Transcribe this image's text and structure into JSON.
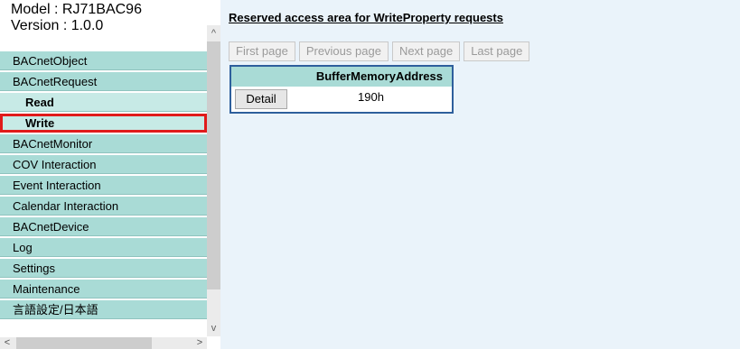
{
  "model": {
    "model_line": "Model : RJ71BAC96",
    "version_line": "Version : 1.0.0"
  },
  "menu": [
    {
      "label": "BACnetObject",
      "name": "menu-item-bacnetobject",
      "sub": false,
      "selected": false
    },
    {
      "label": "BACnetRequest",
      "name": "menu-item-bacnetrequest",
      "sub": false,
      "selected": false
    },
    {
      "label": "Read",
      "name": "menu-item-read",
      "sub": true,
      "selected": false
    },
    {
      "label": "Write",
      "name": "menu-item-write",
      "sub": true,
      "selected": true
    },
    {
      "label": "BACnetMonitor",
      "name": "menu-item-bacnetmonitor",
      "sub": false,
      "selected": false
    },
    {
      "label": "COV Interaction",
      "name": "menu-item-cov-interaction",
      "sub": false,
      "selected": false
    },
    {
      "label": "Event Interaction",
      "name": "menu-item-event-interaction",
      "sub": false,
      "selected": false
    },
    {
      "label": "Calendar Interaction",
      "name": "menu-item-calendar-interaction",
      "sub": false,
      "selected": false
    },
    {
      "label": "BACnetDevice",
      "name": "menu-item-bacnetdevice",
      "sub": false,
      "selected": false
    },
    {
      "label": "Log",
      "name": "menu-item-log",
      "sub": false,
      "selected": false
    },
    {
      "label": "Settings",
      "name": "menu-item-settings",
      "sub": false,
      "selected": false
    },
    {
      "label": "Maintenance",
      "name": "menu-item-maintenance",
      "sub": false,
      "selected": false
    },
    {
      "label": "言語設定/日本語",
      "name": "menu-item-language",
      "sub": false,
      "selected": false
    }
  ],
  "main": {
    "heading": "Reserved access area for WriteProperty requests",
    "pager": {
      "first": "First page",
      "previous": "Previous page",
      "next": "Next page",
      "last": "Last page"
    },
    "table": {
      "header": "BufferMemoryAddress",
      "rows": [
        {
          "button": "Detail",
          "value": "190h"
        }
      ]
    }
  },
  "scroll": {
    "up": "^",
    "down": "v",
    "left": "<",
    "right": ">"
  },
  "colors": {
    "menu_bg": "#a9dbd6",
    "selected_outline": "#e01b1b",
    "content_bg": "#eaf3fa",
    "table_border": "#2e5f9c"
  }
}
